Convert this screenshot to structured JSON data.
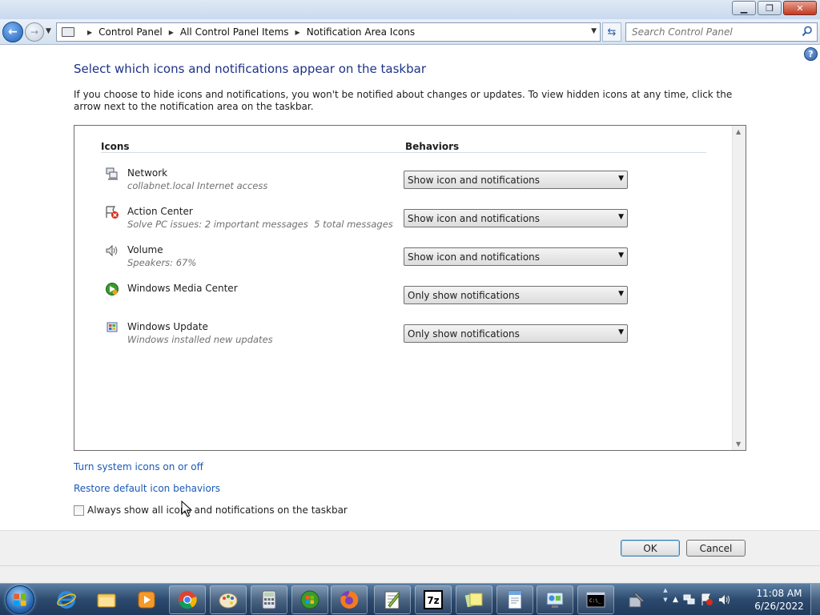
{
  "window": {
    "controls": [
      "minimize",
      "maximize",
      "close"
    ]
  },
  "nav": {
    "breadcrumbs": [
      "Control Panel",
      "All Control Panel Items",
      "Notification Area Icons"
    ],
    "search_placeholder": "Search Control Panel"
  },
  "main": {
    "title": "Select which icons and notifications appear on the taskbar",
    "description": "If you choose to hide icons and notifications, you won't be notified about changes or updates. To view hidden icons at any time, click the arrow next to the notification area on the taskbar.",
    "col_icons": "Icons",
    "col_behaviors": "Behaviors",
    "rows": [
      {
        "name": "Network",
        "sub": "collabnet.local Internet access",
        "behavior": "Show icon and notifications",
        "icon": "network-icon"
      },
      {
        "name": "Action Center",
        "sub": "Solve PC issues: 2 important messages  5 total messages",
        "behavior": "Show icon and notifications",
        "icon": "action-center-icon"
      },
      {
        "name": "Volume",
        "sub": "Speakers: 67%",
        "behavior": "Show icon and notifications",
        "icon": "volume-icon"
      },
      {
        "name": "Windows Media Center",
        "sub": "",
        "behavior": "Only show notifications",
        "icon": "media-center-icon"
      },
      {
        "name": "Windows Update",
        "sub": "Windows installed new updates",
        "behavior": "Only show notifications",
        "icon": "windows-update-icon"
      }
    ],
    "link_system_icons": "Turn system icons on or off",
    "link_restore": "Restore default icon behaviors",
    "always_show_label": "Always show all icons and notifications on the taskbar",
    "always_show_checked": false
  },
  "buttons": {
    "ok": "OK",
    "cancel": "Cancel"
  },
  "taskbar": {
    "apps": [
      "internet-explorer",
      "file-explorer",
      "media-player",
      "chrome",
      "paint",
      "calculator",
      "media-center",
      "firefox",
      "notepad-plus-plus",
      "7-zip",
      "sticky-notes",
      "wordpad",
      "control-panel",
      "command-prompt",
      "tools"
    ],
    "time": "11:08 AM",
    "date": "6/26/2022"
  },
  "colors": {
    "title_blue": "#1e3287",
    "link_blue": "#1b59b5",
    "taskbar": "#2c4a6e"
  }
}
